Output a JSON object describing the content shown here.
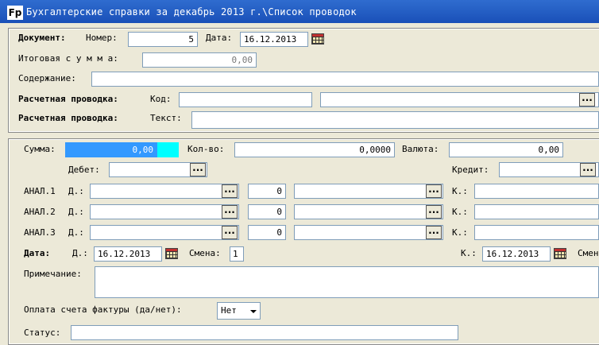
{
  "window": {
    "title": "Бухгалтерские справки за декабрь 2013 г.\\Список проводок",
    "icon_text": "Fp"
  },
  "header": {
    "document_label": "Документ:",
    "number_label": "Номер:",
    "number_value": "5",
    "date_label": "Дата:",
    "date_value": "16.12.2013",
    "total_label": "Итоговая с у м м а:",
    "total_value": "0,00",
    "content_label": "Содержание:",
    "content_value": "",
    "posting_label": "Расчетная проводка:",
    "code_label": "Код:",
    "code_value": "",
    "code_name_value": "",
    "text_label": "Текст:",
    "text_value": ""
  },
  "detail": {
    "sum_label": "Сумма:",
    "sum_value": "0,00",
    "qty_label": "Кол-во:",
    "qty_value": "0,0000",
    "currency_label": "Валюта:",
    "currency_value": "0,00",
    "debit_label": "Дебет:",
    "credit_label": "Кредит:",
    "anal": [
      {
        "label": "АНАЛ.1",
        "d_label": "Д.:",
        "num": "0",
        "k_label": "К.:"
      },
      {
        "label": "АНАЛ.2",
        "d_label": "Д.:",
        "num": "0",
        "k_label": "К.:"
      },
      {
        "label": "АНАЛ.3",
        "d_label": "Д.:",
        "num": "0",
        "k_label": "К.:"
      }
    ],
    "date_label": "Дата:",
    "date_d_label": "Д.:",
    "date_d_value": "16.12.2013",
    "shift_label": "Смена:",
    "shift_value": "1",
    "date_k_label": "К.:",
    "date_k_value": "16.12.2013",
    "shift2_label": "Смен",
    "note_label": "Примечание:",
    "invoice_label": "Оплата счета фактуры (да/нет):",
    "invoice_value": "Нет",
    "status_label": "Статус:",
    "dots": "..."
  }
}
